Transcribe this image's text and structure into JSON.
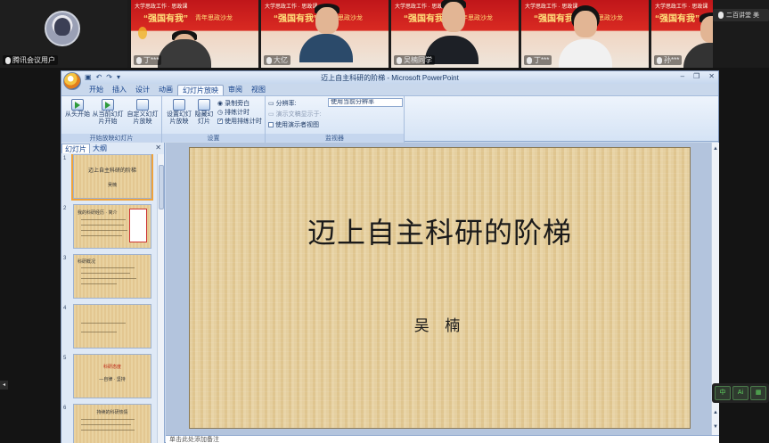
{
  "meeting": {
    "self_tile": {
      "name": "腾讯会议用户"
    },
    "participants": [
      {
        "label": "丁***",
        "banner": "大学思政工作 · 思政课"
      },
      {
        "label": "大亿",
        "banner": "大学思政工作 · 思政课"
      },
      {
        "label": "吴楠同学",
        "banner": "大学思政工作 · 思政课"
      },
      {
        "label": "丁***",
        "banner": "大学思政工作 · 思政课"
      },
      {
        "label": "孙***",
        "banner": "大学思政工作 · 思政课"
      }
    ],
    "slogan": "“强国有我”",
    "slogan_sub": "青年思政沙龙",
    "camera_tile_label": "二百讲堂 美"
  },
  "powerpoint": {
    "window_title": "迈上自主科研的阶梯 - Microsoft PowerPoint",
    "qat": [
      "▣",
      "↶",
      "↷",
      "▾"
    ],
    "win_controls": [
      "–",
      "❐",
      "✕"
    ],
    "tabs": [
      "开始",
      "插入",
      "设计",
      "动画",
      "幻灯片放映",
      "审阅",
      "视图"
    ],
    "active_tab": "幻灯片放映",
    "ribbon": {
      "group1": {
        "label": "开始放映幻灯片",
        "buttons": [
          "从头开始",
          "从当前幻灯片开始",
          "自定义幻灯片放映"
        ]
      },
      "group2": {
        "label": "设置",
        "buttons": [
          "设置幻灯片放映",
          "隐藏幻灯片"
        ],
        "small": [
          "录制旁白",
          "排练计时",
          "使用排练计时"
        ]
      },
      "group3": {
        "label": "监视器",
        "resolution_label": "分辨率:",
        "resolution_value": "使用当前分辨率",
        "show_on_label": "演示文稿显示于:",
        "presenter_view": "使用演示者视图"
      }
    },
    "pane_tabs": [
      "幻灯片",
      "大纲"
    ],
    "active_pane_tab": "幻灯片",
    "thumbnails": [
      {
        "num": "1",
        "title": "迈上自主科研的阶梯",
        "sub": "吴楠"
      },
      {
        "num": "2",
        "title": "我的科研经历 · 简介",
        "sub": ""
      },
      {
        "num": "3",
        "title": "科研概况",
        "sub": ""
      },
      {
        "num": "4",
        "title": "",
        "sub": ""
      },
      {
        "num": "5",
        "title": "科研态度",
        "sub": "—自律 · 坚持"
      },
      {
        "num": "6",
        "title": "持续的科研热情",
        "sub": ""
      }
    ],
    "slide": {
      "title": "迈上自主科研的阶梯",
      "author": "吴 楠"
    },
    "notes_placeholder": "单击此处添加备注"
  },
  "float_bar": [
    "中",
    "Ai",
    "▦"
  ],
  "colors": {
    "ribbon_blue": "#d5e3f5",
    "slide_parchment": "#e5cf9f",
    "meeting_bg": "#141414",
    "banner_red": "#c0161a"
  }
}
